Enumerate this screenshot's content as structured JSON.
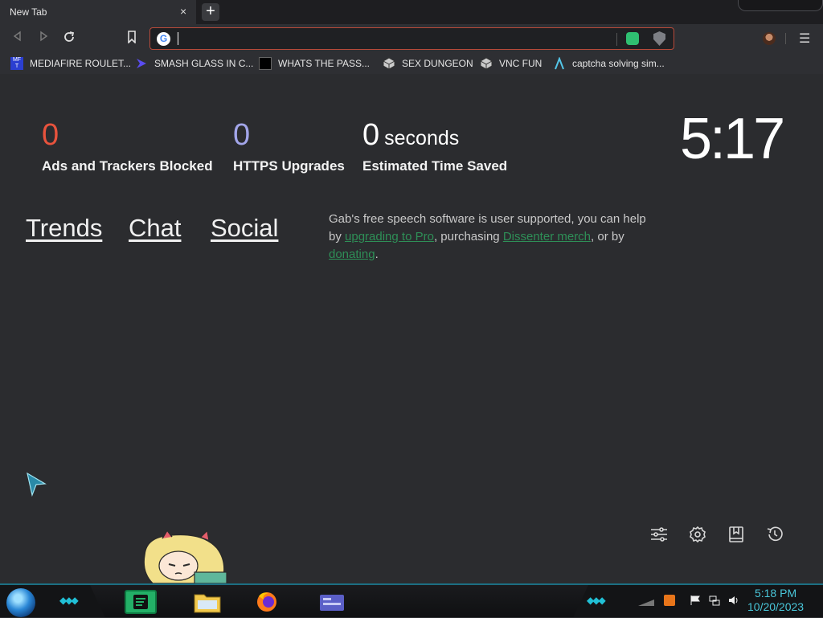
{
  "browser": {
    "tab_title": "New Tab",
    "tab_close": "×",
    "new_tab": "+",
    "url_value": "",
    "menu": "☰"
  },
  "bookmarks": [
    {
      "label": "MEDIAFIRE ROULET...",
      "icon": "mediafire-icon"
    },
    {
      "label": "SMASH GLASS IN C...",
      "icon": "chevron-logo-icon"
    },
    {
      "label": "WHATS THE PASS...",
      "icon": "dark-square-icon"
    },
    {
      "label": "SEX DUNGEON",
      "icon": "cube-icon"
    },
    {
      "label": "VNC FUN",
      "icon": "cube-icon"
    },
    {
      "label": "captcha solving sim...",
      "icon": "lambda-icon"
    }
  ],
  "stats": {
    "ads_count": "0",
    "ads_label": "Ads and Trackers Blocked",
    "ads_color": "#e8533d",
    "https_count": "0",
    "https_label": "HTTPS Upgrades",
    "https_color": "#a3a6ea",
    "time_count": "0",
    "time_unit": "seconds",
    "time_label": "Estimated Time Saved"
  },
  "clock": "5:17",
  "nav_links": {
    "trends": "Trends",
    "chat": "Chat",
    "social": "Social"
  },
  "support": {
    "text1": "Gab's free speech software is user supported, you can help by ",
    "link1": "upgrading to Pro",
    "text2": ", purchasing ",
    "link2": "Dissenter merch",
    "text3": ", or by ",
    "link3": "donating",
    "text4": "."
  },
  "taskbar": {
    "time": "5:18 PM",
    "date": "10/20/2023",
    "accent": "#1c6f83"
  }
}
